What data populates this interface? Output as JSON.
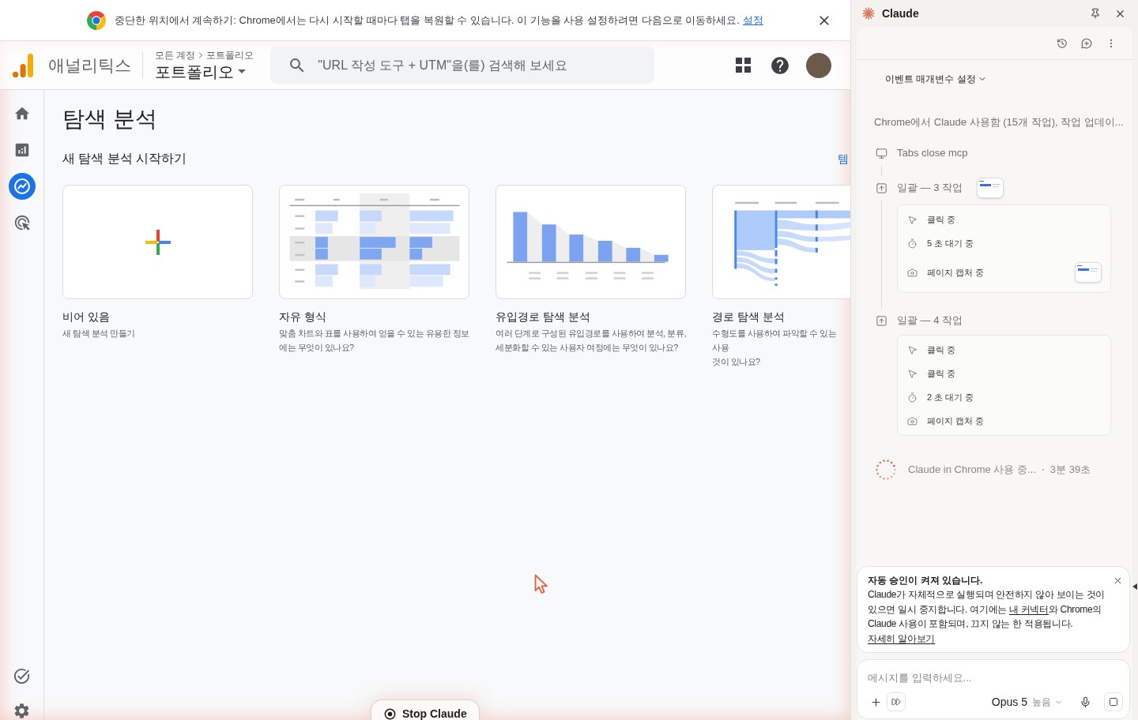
{
  "chrome_banner": {
    "message": "중단한 위치에서 계속하기: Chrome에서는 다시 시작할 때마다 탭을 복원할 수 있습니다. 이 기능을 사용 설정하려면 다음으로 이동하세요.",
    "link": "설정"
  },
  "header": {
    "product": "애널리틱스",
    "breadcrumb": [
      "모든 계정",
      "포트폴리오"
    ],
    "property": "포트폴리오",
    "search": {
      "placeholder": "\"URL 작성 도구 + UTM\"을(를) 검색해 보세요"
    }
  },
  "nav": {
    "items": [
      {
        "selected": false
      },
      {
        "selected": false
      },
      {
        "selected": true
      },
      {
        "selected": false
      }
    ]
  },
  "page": {
    "title": "탐색 분석",
    "subtitle": "새 탐색 분석 시작하기",
    "link": "템",
    "templates": [
      {
        "kind": "blank",
        "title": "비어 있음",
        "description": [
          "새 탐색 분석 만들기"
        ]
      },
      {
        "kind": "free_form",
        "title": "자유 형식",
        "description": [
          "맞춤 차트와 표를 사용하여 얻을 수 있는 유용한 정보",
          "에는 무엇이 있나요?"
        ]
      },
      {
        "kind": "funnel",
        "title": "유입경로 탐색 분석",
        "description": [
          "여러 단계로 구성된 유입경로를 사용하여 분석, 분류,",
          "세분화할 수 있는 사용자 여정에는 무엇이 있나요?"
        ]
      },
      {
        "kind": "path",
        "title": "경로 탐색 분석",
        "description": [
          "수형도를 사용하여 파악할 수 있는 사용",
          "것이 있나요?"
        ]
      }
    ]
  },
  "stop_button": {
    "label": "Stop Claude"
  },
  "claude_panel": {
    "title": "Claude",
    "topic": "이벤트 매개변수 설정",
    "summary": "Chrome에서 Claude 사용함 (15개 작업), 작업 업데이...",
    "steps": [
      {
        "kind": "tab",
        "label": "Tabs close mcp"
      },
      {
        "kind": "batch",
        "label": "일괄 — 3 작업",
        "thumbnail": true,
        "children": [
          {
            "kind": "click",
            "label": "클릭 중"
          },
          {
            "kind": "wait",
            "label": "5 초 대기 중"
          },
          {
            "kind": "capture",
            "label": "페이지 캡처 중",
            "thumbnail": true
          }
        ]
      },
      {
        "kind": "batch",
        "label": "일괄 — 4 작업",
        "children": [
          {
            "kind": "click",
            "label": "클릭 중"
          },
          {
            "kind": "click",
            "label": "클릭 중"
          },
          {
            "kind": "wait",
            "label": "2 초 대기 중"
          },
          {
            "kind": "capture",
            "label": "페이지 캡처 중"
          }
        ]
      }
    ],
    "status": {
      "label": "Claude in Chrome 사용 중...",
      "elapsed": "3분 39초"
    },
    "notice": {
      "title": "자동 승인이 켜져 있습니다.",
      "body": [
        {
          "kind": "text",
          "text": "Claude가 자체적으로 실행되며 안전하지 않아 보이는 것이 있으면 일시 중지합니다. 여기에는 "
        },
        {
          "kind": "link",
          "text": "내 커넥터"
        },
        {
          "kind": "text",
          "text": "와 Chrome의 Claude 사용이 포함되며, 끄지 않는 한 적용됩니다. "
        },
        {
          "kind": "link",
          "text": "자세히 알아보기"
        }
      ]
    },
    "composer": {
      "placeholder": "메시지를 입력하세요...",
      "model": "Opus 5",
      "effort": "높음"
    }
  }
}
